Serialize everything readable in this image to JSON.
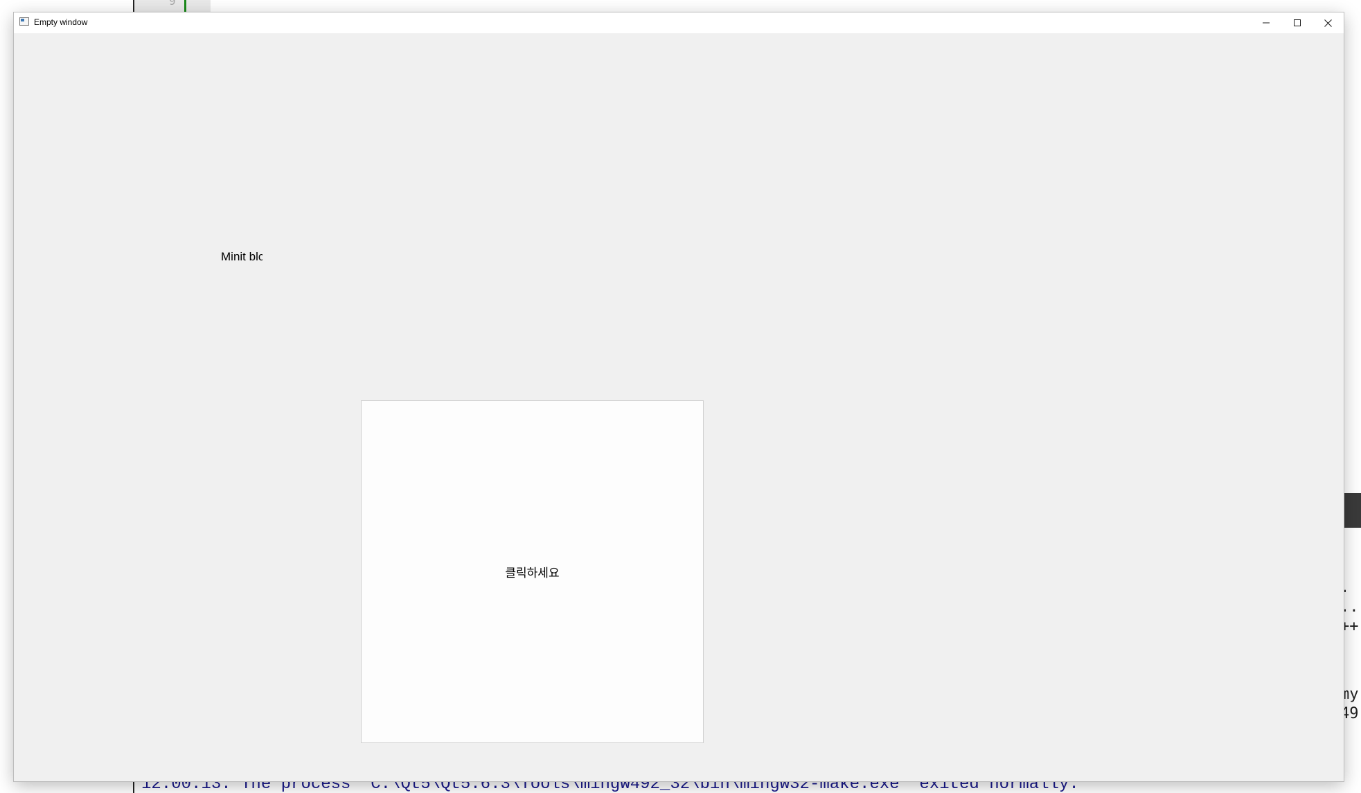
{
  "window": {
    "title": "Empty window",
    "controls": {
      "minimize": "minimize-icon",
      "maximize": "maximize-icon",
      "close": "close-icon"
    }
  },
  "main": {
    "label_text": "Minit blc",
    "button_label": "클릭하세요"
  },
  "background": {
    "editor_line_digit": "9",
    "right_fragments": [
      ".",
      "..",
      "++",
      "my",
      "49"
    ],
    "output_line": "12:00:13: The process \"C:\\Qt5\\Qt5.6.3\\Tools\\mingw492_32\\bin\\mingw32-make.exe\" exited normally."
  },
  "colors": {
    "window_bg": "#f0f0f0",
    "titlebar_bg": "#ffffff",
    "output_text": "#1a1a8c",
    "editor_marker": "#1a8a1a"
  }
}
